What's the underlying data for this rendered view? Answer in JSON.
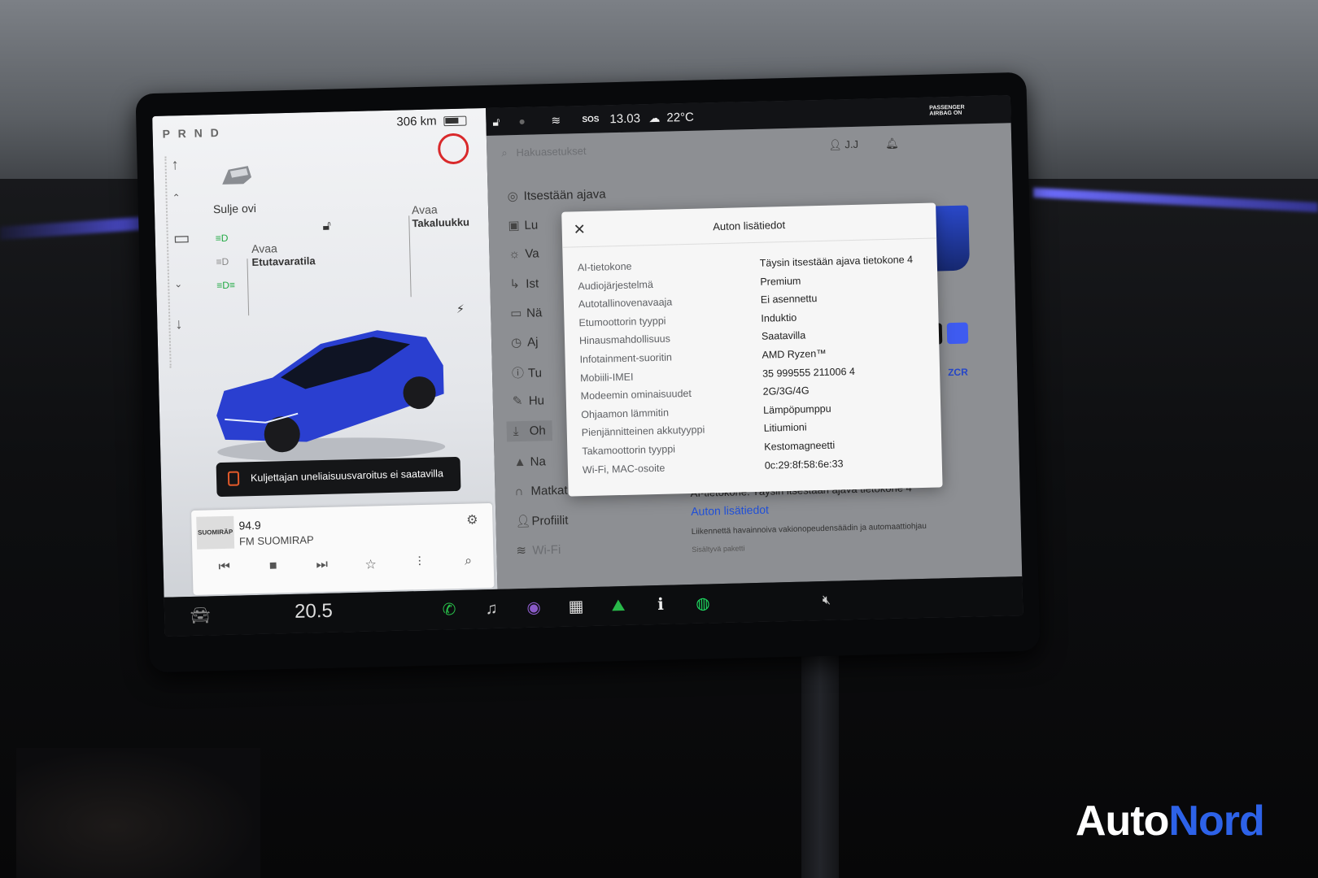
{
  "status_bar": {
    "sos": "SOS",
    "time": "13.03",
    "temperature": "22°C",
    "airbag": "PASSENGER AIRBAG ON"
  },
  "car_panel": {
    "prnd": "P R N D",
    "range": "306 km",
    "battery_level": 0.65,
    "close_door": "Sulje ovi",
    "open_frunk_line1": "Avaa",
    "open_frunk_line2": "Etutavaratila",
    "open_trunk_line1": "Avaa",
    "open_trunk_line2": "Takaluukku",
    "car_color": "#2a3fd0",
    "drowsiness_warning": "Kuljettajan uneliaisuusvaroitus ei saatavilla"
  },
  "media": {
    "logo": "SUOMIRÄP",
    "frequency": "94.9",
    "station": "FM SUOMIRAP",
    "controls": [
      "prev-icon",
      "stop-icon",
      "next-icon",
      "star-icon",
      "equalizer-icon",
      "search-icon"
    ]
  },
  "settings": {
    "search_placeholder": "Hakuasetukset",
    "user": "J.J",
    "nav": [
      {
        "label": "Itsestään ajava",
        "icon": "steering-icon"
      },
      {
        "label": "Lu",
        "icon": "lock-icon"
      },
      {
        "label": "Va",
        "icon": "light-icon"
      },
      {
        "label": "Ist",
        "icon": "seat-icon"
      },
      {
        "label": "Nä",
        "icon": "display-icon"
      },
      {
        "label": "Aj",
        "icon": "clock-icon"
      },
      {
        "label": "Tu",
        "icon": "info-icon"
      },
      {
        "label": "Hu",
        "icon": "wrench-icon"
      },
      {
        "label": "Oh",
        "icon": "download-icon"
      },
      {
        "label": "Na",
        "icon": "navigation-icon"
      },
      {
        "label": "Matkat",
        "icon": "trips-icon"
      },
      {
        "label": "Profiilit",
        "icon": "profile-icon"
      },
      {
        "label": "Wi-Fi",
        "icon": "wifi-icon"
      }
    ],
    "zcr": "ZCR",
    "ai_computer_line": "AI-tietokone: Täysin itsestään ajava tietokone 4",
    "details_link": "Auton lisätiedot",
    "fine_print": "Liikennettä havainnoiva vakionopeudensäädin ja automaattiohjau",
    "fine_print_2": "Sisältyvä paketti",
    "accent": "#1f4fd8"
  },
  "modal": {
    "title": "Auton lisätiedot",
    "rows": [
      {
        "key": "AI-tietokone",
        "value": "Täysin itsestään ajava tietokone 4"
      },
      {
        "key": "Audiojärjestelmä",
        "value": "Premium"
      },
      {
        "key": "Autotallinovenavaaja",
        "value": "Ei asennettu"
      },
      {
        "key": "Etumoottorin tyyppi",
        "value": "Induktio"
      },
      {
        "key": "Hinausmahdollisuus",
        "value": "Saatavilla"
      },
      {
        "key": "Infotainment-suoritin",
        "value": "AMD Ryzen™"
      },
      {
        "key": "Mobiili-IMEI",
        "value": "35 999555 211006 4"
      },
      {
        "key": "Modeemin ominaisuudet",
        "value": "2G/3G/4G"
      },
      {
        "key": "Ohjaamon lämmitin",
        "value": "Lämpöpumppu"
      },
      {
        "key": "Pienjännitteinen akkutyyppi",
        "value": "Litiumioni"
      },
      {
        "key": "Takamoottorin tyyppi",
        "value": "Kestomagneetti"
      },
      {
        "key": "Wi-Fi, MAC-osoite",
        "value": "0c:29:8f:58:6e:33"
      }
    ]
  },
  "taskbar": {
    "cabin_temp": "20.5",
    "apps": [
      "phone-icon",
      "music-icon",
      "camera-icon",
      "apps-icon",
      "energy-icon",
      "manual-icon",
      "spotify-icon"
    ],
    "volume": "mute-icon"
  },
  "watermark": {
    "part1": "Auto",
    "part2": "Nord"
  }
}
